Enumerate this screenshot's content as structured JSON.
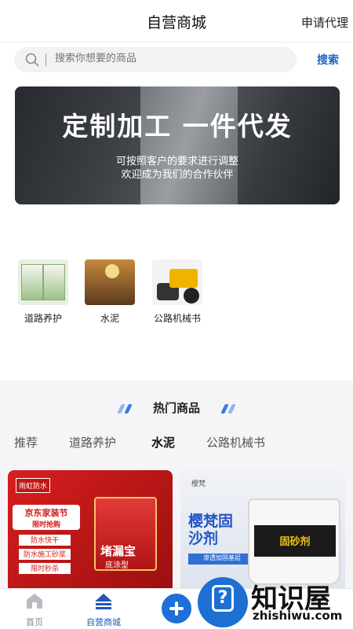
{
  "header": {
    "title": "自营商城",
    "agent_link": "申请代理"
  },
  "search": {
    "placeholder": "搜索你想要的商品",
    "button_label": "搜索"
  },
  "banner": {
    "headline": "定制加工 一件代发",
    "line1": "可按照客户的要求进行调整",
    "line2": "欢迎成为我们的合作伙伴"
  },
  "categories": [
    {
      "label": "道路养护"
    },
    {
      "label": "水泥"
    },
    {
      "label": "公路机械书"
    }
  ],
  "hot_section": {
    "title": "热门商品",
    "deco_color": "#3a7be0"
  },
  "tabs": [
    {
      "label": "推荐"
    },
    {
      "label": "道路养护"
    },
    {
      "label": "水泥",
      "active": true
    },
    {
      "label": "公路机械书"
    }
  ],
  "products": [
    {
      "brand": "雨虹防水",
      "promo_title": "京东家装节",
      "promo_sub": "限时抢购",
      "rows": [
        "防水快干",
        "防水施工砂浆",
        "限时秒杀"
      ],
      "name": "堵漏宝",
      "subname": "底涂型"
    },
    {
      "brand": "樱梵",
      "name": "樱梵固沙剂",
      "tag": "渗透加固基层",
      "bucket_label": "固砂剂"
    }
  ],
  "bottom_nav": [
    {
      "label": "首页",
      "icon": "home-icon"
    },
    {
      "label": "自营商城",
      "icon": "mall-icon",
      "active": true
    }
  ],
  "watermark": {
    "text": "知识屋",
    "url": "zhishiwu.com",
    "icon": "question-icon"
  }
}
